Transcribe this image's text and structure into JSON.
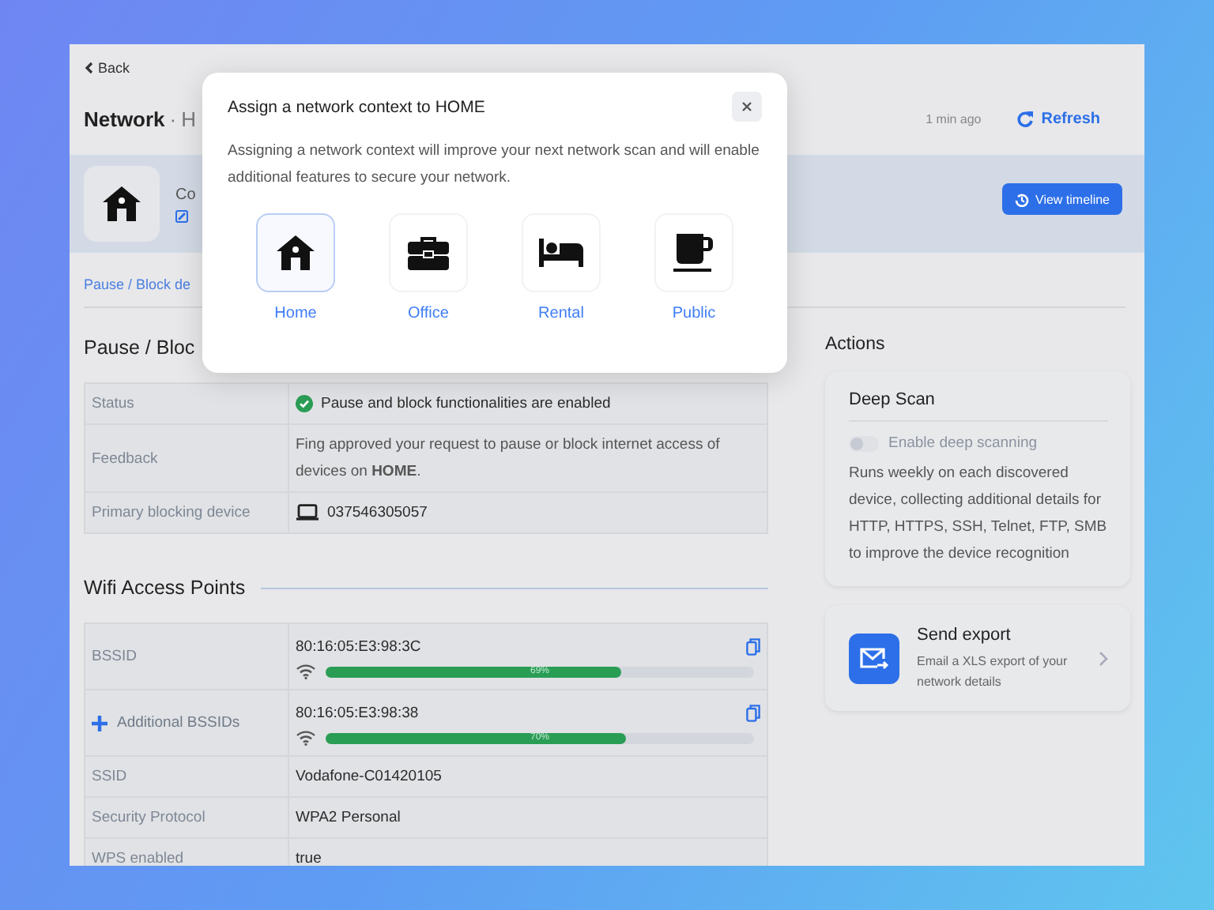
{
  "back": "Back",
  "page": {
    "title": "Network",
    "separator": "·",
    "subtitle": "H",
    "last_scan": "1 min ago",
    "refresh": "Refresh"
  },
  "header": {
    "name": "Co",
    "timeline_button": "View timeline"
  },
  "section_link": "Pause / Block de",
  "pause_block": {
    "title": "Pause / Bloc",
    "rows": [
      {
        "label": "Status",
        "kind": "status",
        "value": "Pause and block functionalities are enabled"
      },
      {
        "label": "Feedback",
        "kind": "text",
        "value": "Fing approved your request to pause or block internet access of devices on **HOME**."
      },
      {
        "label": "Primary blocking device",
        "kind": "device",
        "value": "037546305057"
      }
    ]
  },
  "wifi": {
    "title": "Wifi Access Points",
    "rows": [
      {
        "label": "BSSID",
        "kind": "bssid",
        "value": "80:16:05:E3:98:3C",
        "level": 0.69,
        "reading": "69%"
      },
      {
        "label": "Additional BSSIDs",
        "kind": "bssid",
        "expanded": false,
        "value": "80:16:05:E3:98:38",
        "level": 0.7,
        "reading": "70%"
      },
      {
        "label": "SSID",
        "kind": "text",
        "value": "Vodafone-C01420105"
      },
      {
        "label": "Security Protocol",
        "kind": "text",
        "value": "WPA2 Personal"
      },
      {
        "label": "WPS enabled",
        "kind": "text",
        "value": "true"
      }
    ]
  },
  "actions": {
    "title": "Actions",
    "deep_scan": {
      "title": "Deep Scan",
      "toggle": {
        "label": "Enable deep scanning",
        "on": false
      },
      "description": "Runs weekly on each discovered device, collecting additional details for HTTP, HTTPS, SSH, Telnet, FTP, SMB to improve the device recognition"
    },
    "export": {
      "title": "Send export",
      "description": "Email a XLS export of your network details"
    }
  },
  "modal": {
    "title": "Assign a network context to HOME",
    "description": "Assigning a network context will improve your next network scan and will enable additional features to secure your network.",
    "options": [
      {
        "kind": "home",
        "label": "Home",
        "selected": true
      },
      {
        "kind": "office",
        "label": "Office",
        "selected": false
      },
      {
        "kind": "rental",
        "label": "Rental",
        "selected": false
      },
      {
        "kind": "public",
        "label": "Public",
        "selected": false
      }
    ]
  }
}
